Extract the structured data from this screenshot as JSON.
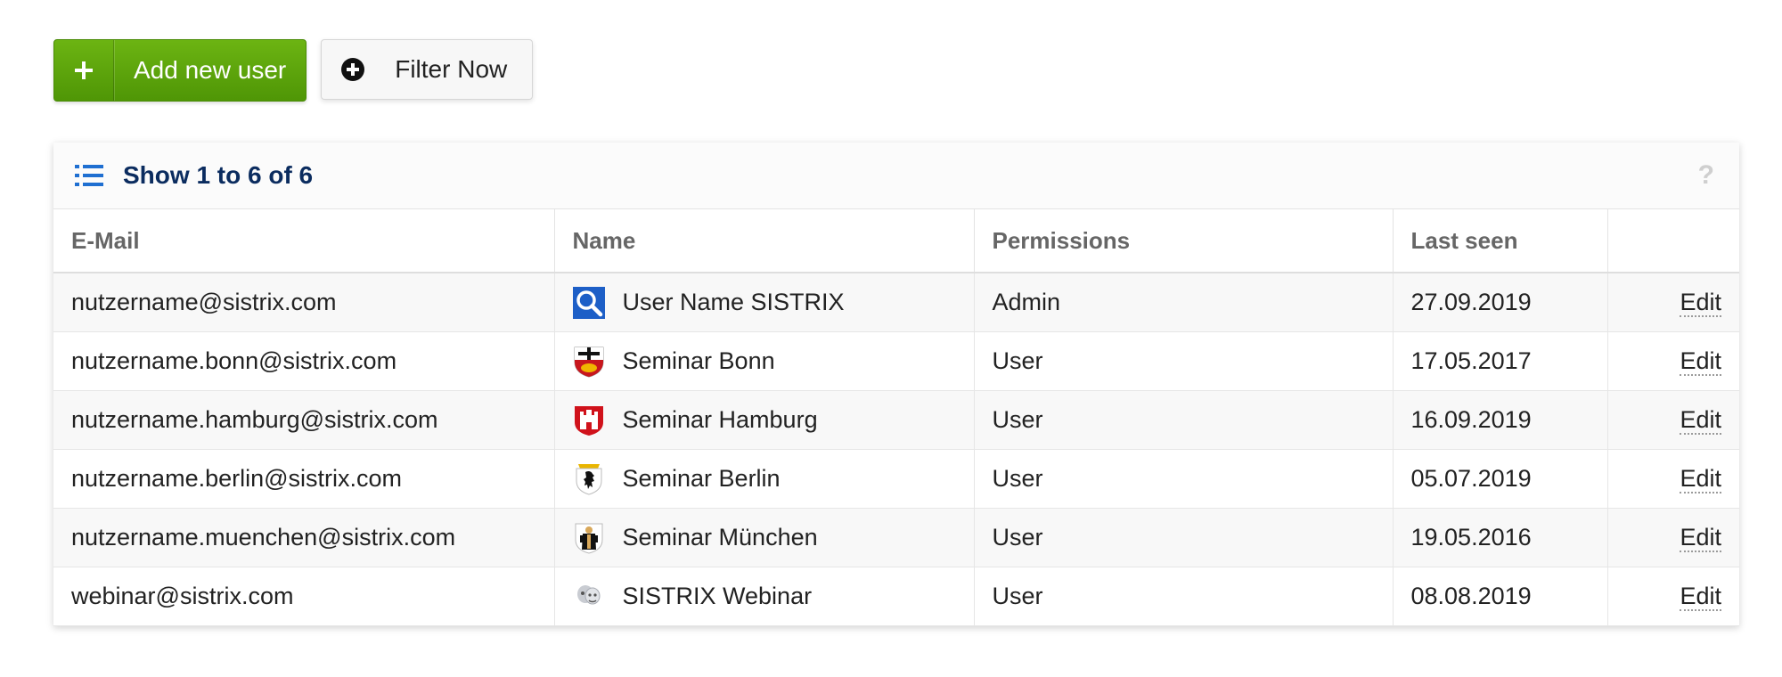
{
  "toolbar": {
    "add_user_label": "Add new user",
    "filter_label": "Filter Now"
  },
  "panel": {
    "title": "Show 1 to 6 of 6",
    "help": "?"
  },
  "table": {
    "columns": [
      "E-Mail",
      "Name",
      "Permissions",
      "Last seen",
      ""
    ],
    "rows": [
      {
        "email": "nutzername@sistrix.com",
        "name": "User Name SISTRIX",
        "permissions": "Admin",
        "last_seen": "27.09.2019",
        "action": "Edit",
        "avatar": "magnifier-icon"
      },
      {
        "email": "nutzername.bonn@sistrix.com",
        "name": "Seminar Bonn",
        "permissions": "User",
        "last_seen": "17.05.2017",
        "action": "Edit",
        "avatar": "bonn-coat-of-arms-icon"
      },
      {
        "email": "nutzername.hamburg@sistrix.com",
        "name": "Seminar Hamburg",
        "permissions": "User",
        "last_seen": "16.09.2019",
        "action": "Edit",
        "avatar": "hamburg-coat-of-arms-icon"
      },
      {
        "email": "nutzername.berlin@sistrix.com",
        "name": "Seminar Berlin",
        "permissions": "User",
        "last_seen": "05.07.2019",
        "action": "Edit",
        "avatar": "berlin-coat-of-arms-icon"
      },
      {
        "email": "nutzername.muenchen@sistrix.com",
        "name": "Seminar München",
        "permissions": "User",
        "last_seen": "19.05.2016",
        "action": "Edit",
        "avatar": "muenchen-coat-of-arms-icon"
      },
      {
        "email": "webinar@sistrix.com",
        "name": "SISTRIX Webinar",
        "permissions": "User",
        "last_seen": "08.08.2019",
        "action": "Edit",
        "avatar": "webinar-icon"
      }
    ]
  },
  "colors": {
    "accent_green": "#5aa40a",
    "title_navy": "#0b2c5f",
    "list_icon_blue": "#1f6fd1"
  }
}
